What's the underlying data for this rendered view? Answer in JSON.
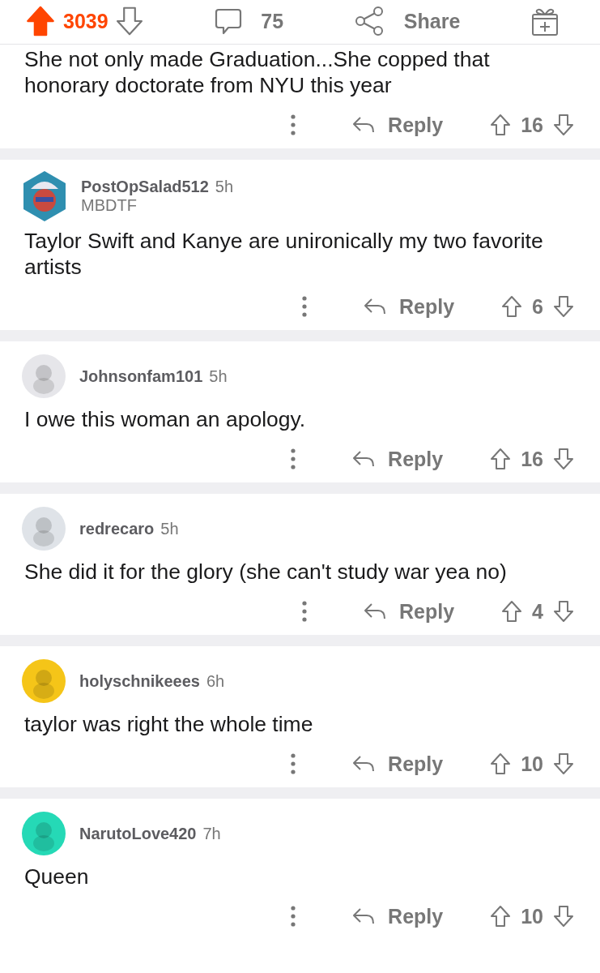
{
  "post_bar": {
    "score": "3039",
    "upvoted": true,
    "comments": "75",
    "share": "Share"
  },
  "partial_comment": {
    "lines": [
      "She not only made Graduation...She copped that",
      "honorary doctorate from NYU this year"
    ],
    "reply": "Reply",
    "score": "16",
    "upvoted": false
  },
  "comments": [
    {
      "author": "PostOpSalad512",
      "age": "5h",
      "flair": "MBDTF",
      "avatar": {
        "kind": "hexagon",
        "color": "#2f8fb0"
      },
      "body": "Taylor Swift and Kanye are unironically my two favorite artists",
      "reply": "Reply",
      "score": "6",
      "upvoted": false
    },
    {
      "author": "Johnsonfam101",
      "age": "5h",
      "avatar": {
        "kind": "circle",
        "color": "#e6e6ea"
      },
      "body": "I owe this woman an apology.",
      "reply": "Reply",
      "score": "16",
      "upvoted": false
    },
    {
      "author": "redrecaro",
      "age": "5h",
      "avatar": {
        "kind": "circle",
        "color": "#dfe3e8"
      },
      "body": "She did it for the glory (she can't study war yea no)",
      "reply": "Reply",
      "score": "4",
      "upvoted": false
    },
    {
      "author": "holyschnikeees",
      "age": "6h",
      "avatar": {
        "kind": "circle",
        "color": "#f5c518"
      },
      "body": "taylor was right the whole time",
      "reply": "Reply",
      "score": "10",
      "upvoted": false
    },
    {
      "author": "NarutoLove420",
      "age": "7h",
      "avatar": {
        "kind": "circle",
        "color": "#25d9b6"
      },
      "body": "Queen",
      "reply": "Reply",
      "score": "10",
      "upvoted": false
    }
  ]
}
